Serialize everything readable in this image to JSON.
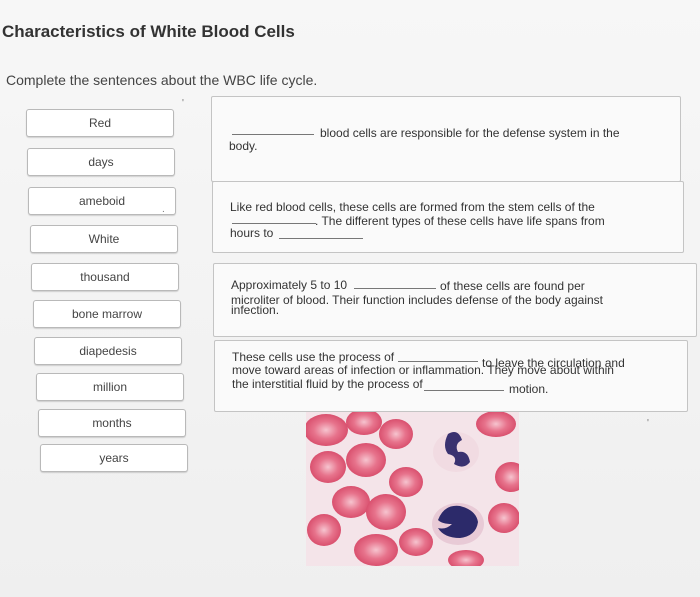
{
  "title": "Characteristics of White Blood Cells",
  "instruction": "Complete the sentences about the WBC life cycle.",
  "word_bank": [
    "Red",
    "days",
    "ameboid",
    "White",
    "thousand",
    "bone marrow",
    "diapedesis",
    "million",
    "months",
    "years"
  ],
  "sentences": {
    "s1": {
      "line1": "blood cells are responsible for the defense system in the",
      "line2": "body."
    },
    "s2": {
      "line1": "Like red blood cells, these cells are formed from the stem cells of the",
      "line2": ". The different types of these cells have life spans from",
      "line3": "hours to"
    },
    "s3": {
      "line1a": "Approximately 5 to 10",
      "line1b": "of these cells are found per",
      "line2": "microliter of blood. Their function includes defense of the body against",
      "line3": "infection."
    },
    "s4": {
      "line1a": "These cells use the process of",
      "line1b": "to leave the circulation and",
      "line2": "move toward areas of infection or inflammation.  They move about within",
      "line3a": "the interstitial fluid by the process of",
      "line3b": "motion."
    }
  },
  "colors": {
    "card_border": "#c4c4c4",
    "rbc": "#e3607d",
    "nucleus": "#2e2a6e"
  }
}
